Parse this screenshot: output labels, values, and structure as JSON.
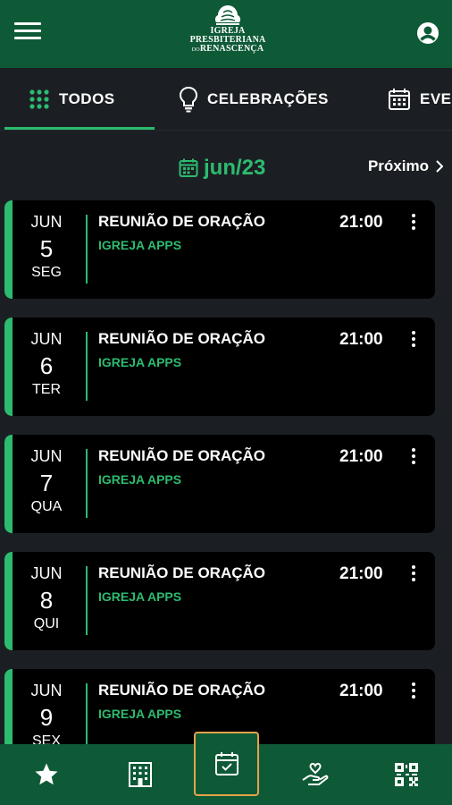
{
  "header": {
    "logo": {
      "line1": "IGREJA",
      "line2": "PRESBITERIANA",
      "line3_small": "DO",
      "line3": "RENASCENÇA"
    }
  },
  "tabs": [
    {
      "label": "TODOS",
      "icon": "grid-dots-icon",
      "active": true
    },
    {
      "label": "CELEBRAÇÕES",
      "icon": "lightbulb-icon",
      "active": false
    },
    {
      "label": "EVE",
      "icon": "calendar-icon",
      "active": false
    }
  ],
  "month_nav": {
    "month": "jun/23",
    "next_label": "Próximo"
  },
  "events": [
    {
      "month": "JUN",
      "day": "5",
      "weekday": "SEG",
      "title": "REUNIÃO DE ORAÇÃO",
      "org": "IGREJA APPS",
      "time": "21:00"
    },
    {
      "month": "JUN",
      "day": "6",
      "weekday": "TER",
      "title": "REUNIÃO DE ORAÇÃO",
      "org": "IGREJA APPS",
      "time": "21:00"
    },
    {
      "month": "JUN",
      "day": "7",
      "weekday": "QUA",
      "title": "REUNIÃO DE ORAÇÃO",
      "org": "IGREJA APPS",
      "time": "21:00"
    },
    {
      "month": "JUN",
      "day": "8",
      "weekday": "QUI",
      "title": "REUNIÃO DE ORAÇÃO",
      "org": "IGREJA APPS",
      "time": "21:00"
    },
    {
      "month": "JUN",
      "day": "9",
      "weekday": "SEX",
      "title": "REUNIÃO DE ORAÇÃO",
      "org": "IGREJA APPS",
      "time": "21:00"
    }
  ],
  "bottom_nav": [
    "star-icon",
    "building-icon",
    "calendar-check-icon",
    "hand-heart-icon",
    "qr-code-icon"
  ],
  "colors": {
    "brand_green": "#0e5a36",
    "accent_green": "#2dbb6f",
    "background": "#1b1f23",
    "card": "#000000",
    "highlight": "#e6a24a"
  }
}
